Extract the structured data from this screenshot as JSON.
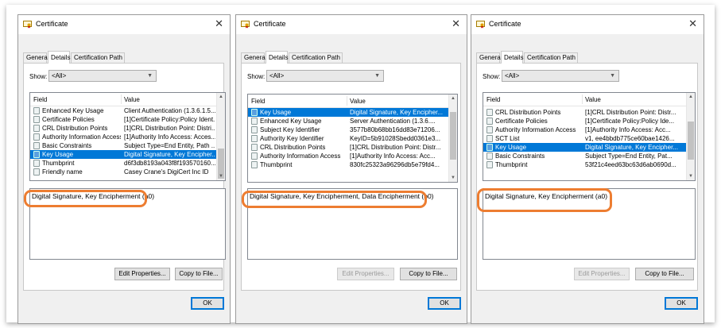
{
  "windows": [
    {
      "title": "Certificate",
      "tabs": [
        "General",
        "Details",
        "Certification Path"
      ],
      "show_label": "Show:",
      "show_value": "<All>",
      "columns": [
        "Field",
        "Value"
      ],
      "rows": [
        {
          "field": "Enhanced Key Usage",
          "value": "Client Authentication (1.3.6.1.5...",
          "selected": false
        },
        {
          "field": "Certificate Policies",
          "value": "[1]Certificate Policy:Policy Ident...",
          "selected": false
        },
        {
          "field": "CRL Distribution Points",
          "value": "[1]CRL Distribution Point: Distri...",
          "selected": false
        },
        {
          "field": "Authority Information Access",
          "value": "[1]Authority Info Access: Acces...",
          "selected": false
        },
        {
          "field": "Basic Constraints",
          "value": "Subject Type=End Entity, Path ...",
          "selected": false
        },
        {
          "field": "Key Usage",
          "value": "Digital Signature, Key Encipher...",
          "selected": true
        },
        {
          "field": "Thumbprint",
          "value": "d6f3db8193a043f8f193570160...",
          "selected": false
        },
        {
          "field": "Friendly name",
          "value": "Casey Crane's DigiCert Inc ID",
          "selected": false
        }
      ],
      "detail_text": "Digital Signature, Key Encipherment (a0)",
      "edit_properties": "Edit Properties...",
      "edit_disabled": false,
      "copy_to_file": "Copy to File...",
      "ok": "OK"
    },
    {
      "title": "Certificate",
      "tabs": [
        "General",
        "Details",
        "Certification Path"
      ],
      "show_label": "Show:",
      "show_value": "<All>",
      "columns": [
        "Field",
        "Value"
      ],
      "rows": [
        {
          "field": "Key Usage",
          "value": "Digital Signature, Key Encipher...",
          "selected": true
        },
        {
          "field": "Enhanced Key Usage",
          "value": "Server Authentication (1.3.6....",
          "selected": false
        },
        {
          "field": "Subject Key Identifier",
          "value": "3577b80b68bb16dd83e71206...",
          "selected": false
        },
        {
          "field": "Authority Key Identifier",
          "value": "KeyID=5b91028Sbedd0361e3...",
          "selected": false
        },
        {
          "field": "CRL Distribution Points",
          "value": "[1]CRL Distribution Point: Distr...",
          "selected": false
        },
        {
          "field": "Authority Information Access",
          "value": "[1]Authority Info Access: Acc...",
          "selected": false
        },
        {
          "field": "Thumbprint",
          "value": "830fc25323a96296db5e79fd4...",
          "selected": false
        }
      ],
      "detail_text": "Digital Signature, Key Encipherment, Data Encipherment (b0)",
      "edit_properties": "Edit Properties...",
      "edit_disabled": true,
      "copy_to_file": "Copy to File...",
      "ok": "OK"
    },
    {
      "title": "Certificate",
      "tabs": [
        "General",
        "Details",
        "Certification Path"
      ],
      "show_label": "Show:",
      "show_value": "<All>",
      "columns": [
        "Field",
        "Value"
      ],
      "rows": [
        {
          "field": "CRL Distribution Points",
          "value": "[1]CRL Distribution Point: Distr...",
          "selected": false
        },
        {
          "field": "Certificate Policies",
          "value": "[1]Certificate Policy:Policy Ide...",
          "selected": false
        },
        {
          "field": "Authority Information Access",
          "value": "[1]Authority Info Access: Acc...",
          "selected": false
        },
        {
          "field": "SCT List",
          "value": "v1, ee4bbdb775ce60bae1426...",
          "selected": false
        },
        {
          "field": "Key Usage",
          "value": "Digital Signature, Key Encipher...",
          "selected": true
        },
        {
          "field": "Basic Constraints",
          "value": "Subject Type=End Entity, Pat...",
          "selected": false
        },
        {
          "field": "Thumbprint",
          "value": "53f21c4eed63bc63d6ab0690d...",
          "selected": false
        }
      ],
      "detail_text": "Digital Signature, Key Encipherment (a0)",
      "edit_properties": "Edit Properties...",
      "edit_disabled": true,
      "copy_to_file": "Copy to File...",
      "ok": "OK"
    }
  ],
  "colors": {
    "selection": "#0078d7",
    "highlight_ring": "#ed7d31",
    "dialog_bg": "#f0f0f0"
  }
}
